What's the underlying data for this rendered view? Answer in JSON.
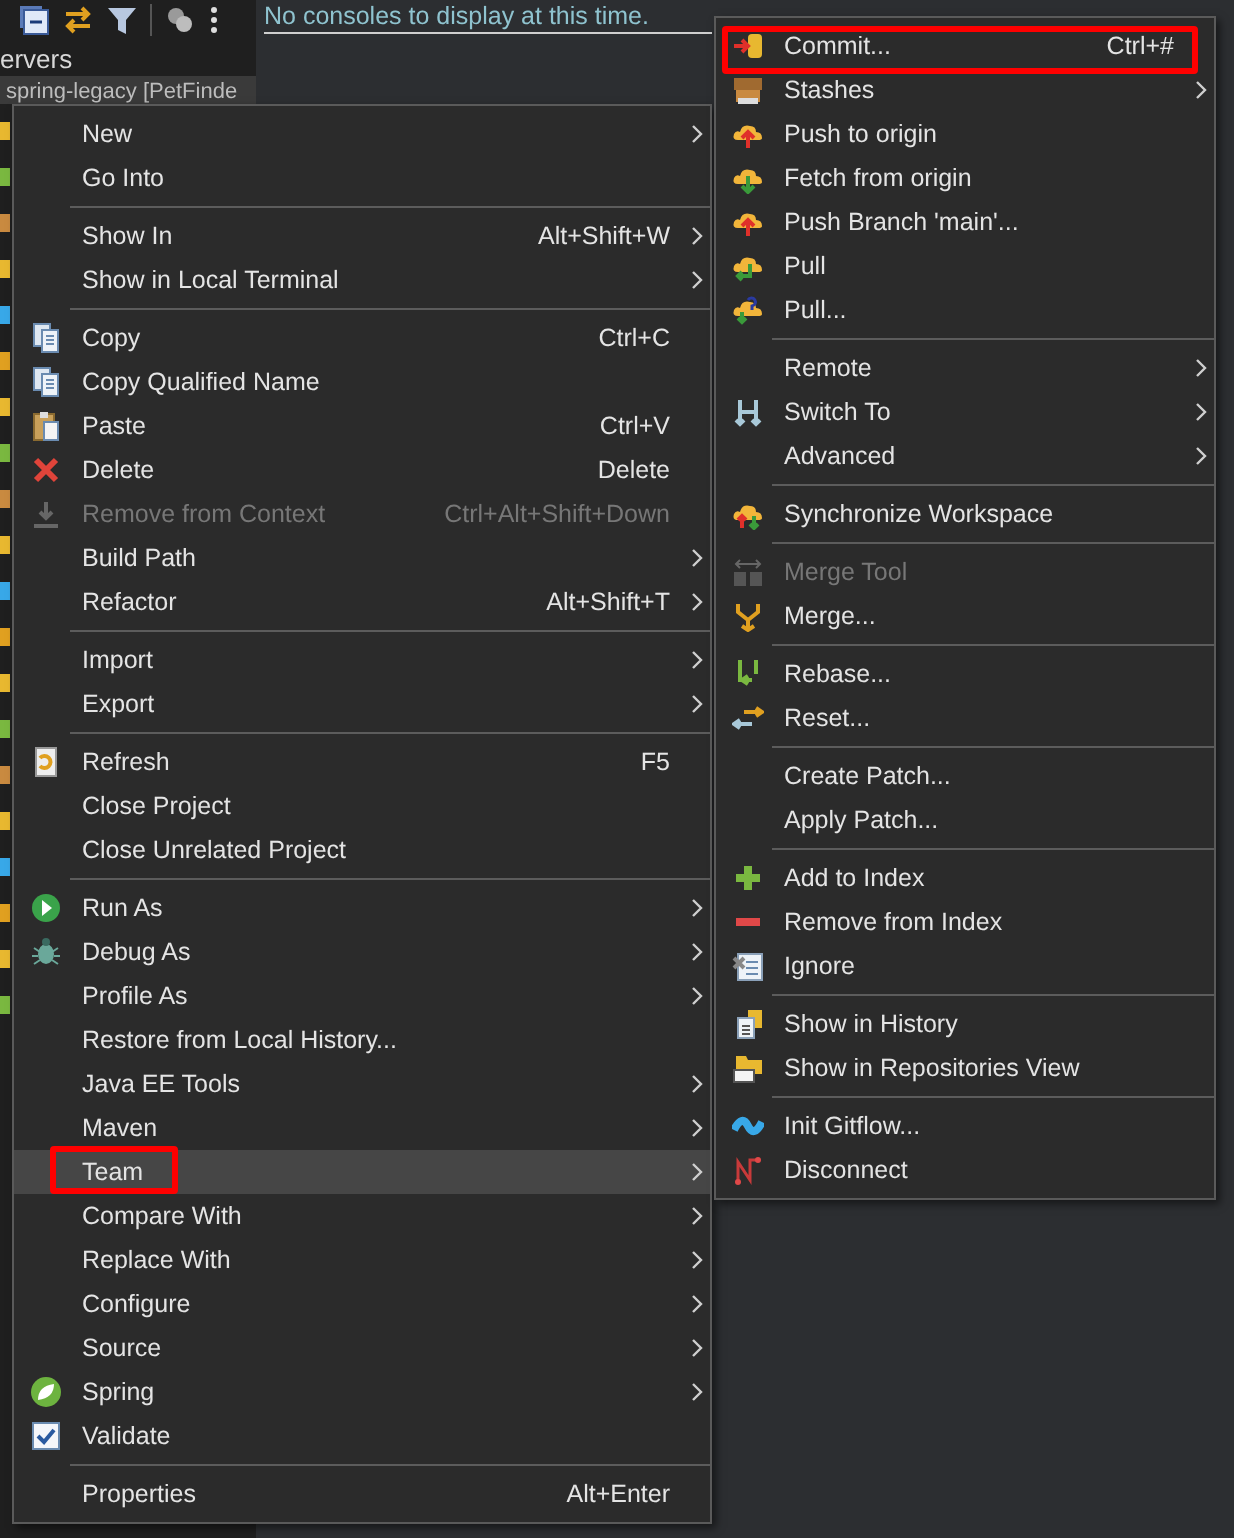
{
  "view_tab": {
    "label": "ervers"
  },
  "project_tree": {
    "item": "spring-legacy [PetFinde"
  },
  "console": {
    "message": "No consoles to display at this time."
  },
  "context_menu": {
    "items": [
      {
        "kind": "item",
        "label": "New",
        "submenu": true,
        "disabled": false,
        "selected": false,
        "marked": false
      },
      {
        "kind": "item",
        "label": "Go Into",
        "submenu": false,
        "disabled": false,
        "selected": false,
        "marked": false
      },
      {
        "kind": "separator"
      },
      {
        "kind": "item",
        "label": "Show In",
        "shortcut": "Alt+Shift+W",
        "submenu": true,
        "disabled": false,
        "selected": false,
        "marked": false
      },
      {
        "kind": "item",
        "label": "Show in Local Terminal",
        "submenu": true,
        "disabled": false,
        "selected": false,
        "marked": false
      },
      {
        "kind": "separator"
      },
      {
        "kind": "item",
        "label": "Copy",
        "shortcut": "Ctrl+C",
        "submenu": false,
        "disabled": false,
        "selected": false,
        "marked": false
      },
      {
        "kind": "item",
        "label": "Copy Qualified Name",
        "submenu": false,
        "disabled": false,
        "selected": false,
        "marked": false
      },
      {
        "kind": "item",
        "label": "Paste",
        "shortcut": "Ctrl+V",
        "submenu": false,
        "disabled": false,
        "selected": false,
        "marked": false
      },
      {
        "kind": "item",
        "label": "Delete",
        "shortcut": "Delete",
        "submenu": false,
        "disabled": false,
        "selected": false,
        "marked": false
      },
      {
        "kind": "item",
        "label": "Remove from Context",
        "shortcut": "Ctrl+Alt+Shift+Down",
        "submenu": false,
        "disabled": true,
        "selected": false,
        "marked": false
      },
      {
        "kind": "item",
        "label": "Build Path",
        "submenu": true,
        "disabled": false,
        "selected": false,
        "marked": false
      },
      {
        "kind": "item",
        "label": "Refactor",
        "shortcut": "Alt+Shift+T",
        "submenu": true,
        "disabled": false,
        "selected": false,
        "marked": false
      },
      {
        "kind": "separator"
      },
      {
        "kind": "item",
        "label": "Import",
        "submenu": true,
        "disabled": false,
        "selected": false,
        "marked": false
      },
      {
        "kind": "item",
        "label": "Export",
        "submenu": true,
        "disabled": false,
        "selected": false,
        "marked": false
      },
      {
        "kind": "separator"
      },
      {
        "kind": "item",
        "label": "Refresh",
        "shortcut": "F5",
        "submenu": false,
        "disabled": false,
        "selected": false,
        "marked": false
      },
      {
        "kind": "item",
        "label": "Close Project",
        "submenu": false,
        "disabled": false,
        "selected": false,
        "marked": false
      },
      {
        "kind": "item",
        "label": "Close Unrelated Project",
        "submenu": false,
        "disabled": false,
        "selected": false,
        "marked": false
      },
      {
        "kind": "separator"
      },
      {
        "kind": "item",
        "label": "Run As",
        "submenu": true,
        "disabled": false,
        "selected": false,
        "marked": false
      },
      {
        "kind": "item",
        "label": "Debug As",
        "submenu": true,
        "disabled": false,
        "selected": false,
        "marked": false
      },
      {
        "kind": "item",
        "label": "Profile As",
        "submenu": true,
        "disabled": false,
        "selected": false,
        "marked": false
      },
      {
        "kind": "item",
        "label": "Restore from Local History...",
        "submenu": false,
        "disabled": false,
        "selected": false,
        "marked": false
      },
      {
        "kind": "item",
        "label": "Java EE Tools",
        "submenu": true,
        "disabled": false,
        "selected": false,
        "marked": false
      },
      {
        "kind": "item",
        "label": "Maven",
        "submenu": true,
        "disabled": false,
        "selected": false,
        "marked": false
      },
      {
        "kind": "item",
        "label": "Team",
        "submenu": true,
        "disabled": false,
        "selected": true,
        "marked": true
      },
      {
        "kind": "item",
        "label": "Compare With",
        "submenu": true,
        "disabled": false,
        "selected": false,
        "marked": false
      },
      {
        "kind": "item",
        "label": "Replace With",
        "submenu": true,
        "disabled": false,
        "selected": false,
        "marked": false
      },
      {
        "kind": "item",
        "label": "Configure",
        "submenu": true,
        "disabled": false,
        "selected": false,
        "marked": false
      },
      {
        "kind": "item",
        "label": "Source",
        "submenu": true,
        "disabled": false,
        "selected": false,
        "marked": false
      },
      {
        "kind": "item",
        "label": "Spring",
        "submenu": true,
        "disabled": false,
        "selected": false,
        "marked": false
      },
      {
        "kind": "item",
        "label": "Validate",
        "submenu": false,
        "disabled": false,
        "selected": false,
        "marked": false
      },
      {
        "kind": "separator"
      },
      {
        "kind": "item",
        "label": "Properties",
        "shortcut": "Alt+Enter",
        "submenu": false,
        "disabled": false,
        "selected": false,
        "marked": false
      }
    ]
  },
  "team_submenu": {
    "items": [
      {
        "kind": "item",
        "label": "Commit...",
        "shortcut": "Ctrl+#",
        "submenu": false,
        "disabled": false,
        "selected": false,
        "marked": true
      },
      {
        "kind": "item",
        "label": "Stashes",
        "submenu": true,
        "disabled": false,
        "selected": false,
        "marked": false
      },
      {
        "kind": "item",
        "label": "Push to origin",
        "submenu": false,
        "disabled": false,
        "selected": false,
        "marked": false
      },
      {
        "kind": "item",
        "label": "Fetch from origin",
        "submenu": false,
        "disabled": false,
        "selected": false,
        "marked": false
      },
      {
        "kind": "item",
        "label": "Push Branch 'main'...",
        "submenu": false,
        "disabled": false,
        "selected": false,
        "marked": false
      },
      {
        "kind": "item",
        "label": "Pull",
        "submenu": false,
        "disabled": false,
        "selected": false,
        "marked": false
      },
      {
        "kind": "item",
        "label": "Pull...",
        "submenu": false,
        "disabled": false,
        "selected": false,
        "marked": false
      },
      {
        "kind": "separator"
      },
      {
        "kind": "item",
        "label": "Remote",
        "submenu": true,
        "disabled": false,
        "selected": false,
        "marked": false
      },
      {
        "kind": "item",
        "label": "Switch To",
        "submenu": true,
        "disabled": false,
        "selected": false,
        "marked": false
      },
      {
        "kind": "item",
        "label": "Advanced",
        "submenu": true,
        "disabled": false,
        "selected": false,
        "marked": false
      },
      {
        "kind": "separator"
      },
      {
        "kind": "item",
        "label": "Synchronize Workspace",
        "submenu": false,
        "disabled": false,
        "selected": false,
        "marked": false
      },
      {
        "kind": "separator"
      },
      {
        "kind": "item",
        "label": "Merge Tool",
        "submenu": false,
        "disabled": true,
        "selected": false,
        "marked": false
      },
      {
        "kind": "item",
        "label": "Merge...",
        "submenu": false,
        "disabled": false,
        "selected": false,
        "marked": false
      },
      {
        "kind": "separator"
      },
      {
        "kind": "item",
        "label": "Rebase...",
        "submenu": false,
        "disabled": false,
        "selected": false,
        "marked": false
      },
      {
        "kind": "item",
        "label": "Reset...",
        "submenu": false,
        "disabled": false,
        "selected": false,
        "marked": false
      },
      {
        "kind": "separator"
      },
      {
        "kind": "item",
        "label": "Create Patch...",
        "submenu": false,
        "disabled": false,
        "selected": false,
        "marked": false
      },
      {
        "kind": "item",
        "label": "Apply Patch...",
        "submenu": false,
        "disabled": false,
        "selected": false,
        "marked": false
      },
      {
        "kind": "separator"
      },
      {
        "kind": "item",
        "label": "Add to Index",
        "submenu": false,
        "disabled": false,
        "selected": false,
        "marked": false
      },
      {
        "kind": "item",
        "label": "Remove from Index",
        "submenu": false,
        "disabled": false,
        "selected": false,
        "marked": false
      },
      {
        "kind": "item",
        "label": "Ignore",
        "submenu": false,
        "disabled": false,
        "selected": false,
        "marked": false
      },
      {
        "kind": "separator"
      },
      {
        "kind": "item",
        "label": "Show in History",
        "submenu": false,
        "disabled": false,
        "selected": false,
        "marked": false
      },
      {
        "kind": "item",
        "label": "Show in Repositories View",
        "submenu": false,
        "disabled": false,
        "selected": false,
        "marked": false
      },
      {
        "kind": "separator"
      },
      {
        "kind": "item",
        "label": "Init Gitflow...",
        "submenu": false,
        "disabled": false,
        "selected": false,
        "marked": false
      },
      {
        "kind": "item",
        "label": "Disconnect",
        "submenu": false,
        "disabled": false,
        "selected": false,
        "marked": false
      }
    ]
  }
}
